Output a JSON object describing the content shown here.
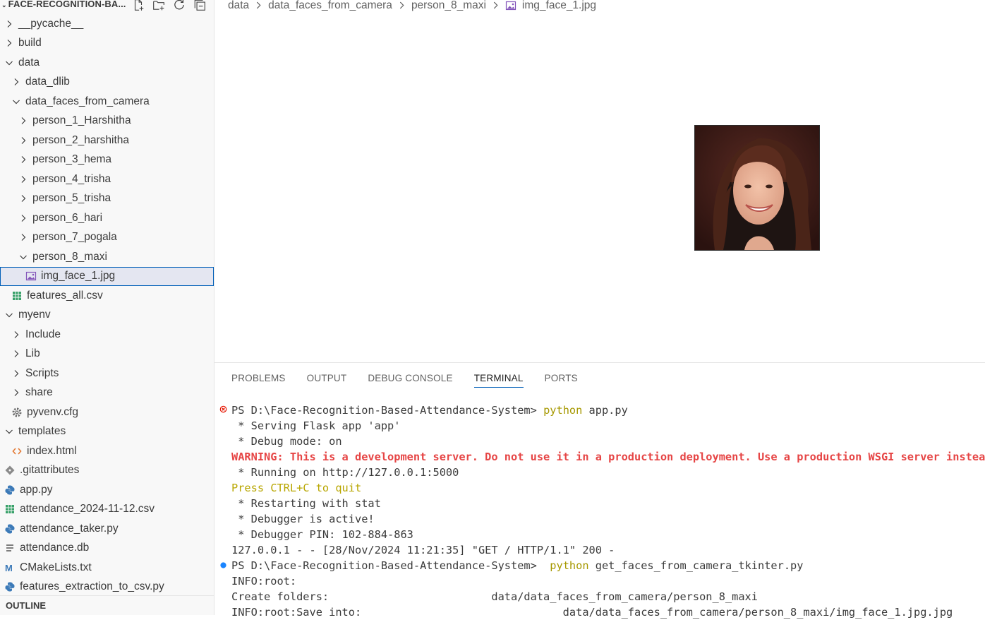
{
  "sidebar": {
    "title": "FACE-RECOGNITION-BA...",
    "header_icons": [
      "new-file-icon",
      "new-folder-icon",
      "refresh-icon",
      "collapse-all-icon"
    ],
    "items": [
      {
        "label": "__pycache__",
        "kind": "folder",
        "expanded": false,
        "depth": 0
      },
      {
        "label": "build",
        "kind": "folder",
        "expanded": false,
        "depth": 0
      },
      {
        "label": "data",
        "kind": "folder",
        "expanded": true,
        "depth": 0
      },
      {
        "label": "data_dlib",
        "kind": "folder",
        "expanded": false,
        "depth": 1
      },
      {
        "label": "data_faces_from_camera",
        "kind": "folder",
        "expanded": true,
        "depth": 1
      },
      {
        "label": "person_1_Harshitha",
        "kind": "folder",
        "expanded": false,
        "depth": 2
      },
      {
        "label": "person_2_harshitha",
        "kind": "folder",
        "expanded": false,
        "depth": 2
      },
      {
        "label": "person_3_hema",
        "kind": "folder",
        "expanded": false,
        "depth": 2
      },
      {
        "label": "person_4_trisha",
        "kind": "folder",
        "expanded": false,
        "depth": 2
      },
      {
        "label": "person_5_trisha",
        "kind": "folder",
        "expanded": false,
        "depth": 2
      },
      {
        "label": "person_6_hari",
        "kind": "folder",
        "expanded": false,
        "depth": 2
      },
      {
        "label": "person_7_pogala",
        "kind": "folder",
        "expanded": false,
        "depth": 2
      },
      {
        "label": "person_8_maxi",
        "kind": "folder",
        "expanded": true,
        "depth": 2
      },
      {
        "label": "img_face_1.jpg",
        "kind": "image",
        "depth": 3,
        "selected": true
      },
      {
        "label": "features_all.csv",
        "kind": "csv",
        "depth": 1
      },
      {
        "label": "myenv",
        "kind": "folder",
        "expanded": true,
        "depth": 0
      },
      {
        "label": "Include",
        "kind": "folder",
        "expanded": false,
        "depth": 1
      },
      {
        "label": "Lib",
        "kind": "folder",
        "expanded": false,
        "depth": 1
      },
      {
        "label": "Scripts",
        "kind": "folder",
        "expanded": false,
        "depth": 1
      },
      {
        "label": "share",
        "kind": "folder",
        "expanded": false,
        "depth": 1
      },
      {
        "label": "pyvenv.cfg",
        "kind": "cfg",
        "depth": 1
      },
      {
        "label": "templates",
        "kind": "folder",
        "expanded": true,
        "depth": 0
      },
      {
        "label": "index.html",
        "kind": "html",
        "depth": 1
      },
      {
        "label": ".gitattributes",
        "kind": "git",
        "depth": 0
      },
      {
        "label": "app.py",
        "kind": "python",
        "depth": 0
      },
      {
        "label": "attendance_2024-11-12.csv",
        "kind": "csv",
        "depth": 0
      },
      {
        "label": "attendance_taker.py",
        "kind": "python",
        "depth": 0
      },
      {
        "label": "attendance.db",
        "kind": "db",
        "depth": 0
      },
      {
        "label": "CMakeLists.txt",
        "kind": "cmake",
        "depth": 0
      },
      {
        "label": "features_extraction_to_csv.py",
        "kind": "python",
        "depth": 0
      }
    ],
    "outline_label": "OUTLINE"
  },
  "breadcrumb": [
    "data",
    "data_faces_from_camera",
    "person_8_maxi",
    "img_face_1.jpg"
  ],
  "colors": {
    "accent": "#005fb8",
    "folder_twisty": "#3b3b3b",
    "csv_icon": "#38a169",
    "python_icon": "#3c7ab8",
    "html_icon": "#e37933",
    "image_icon": "#8354ba",
    "terminal_error": "#e64545",
    "terminal_command": "#a69800",
    "terminal_success_dot": "#1a85ff",
    "terminal_error_dot": "#e51400"
  },
  "panel": {
    "tabs": [
      {
        "label": "PROBLEMS",
        "active": false
      },
      {
        "label": "OUTPUT",
        "active": false
      },
      {
        "label": "DEBUG CONSOLE",
        "active": false
      },
      {
        "label": "TERMINAL",
        "active": true
      },
      {
        "label": "PORTS",
        "active": false
      }
    ]
  },
  "terminal": {
    "prompt1": "PS D:\\Face-Recognition-Based-Attendance-System> ",
    "cmd1_name": "python",
    "cmd1_arg": " app.py",
    "l2": " * Serving Flask app 'app'",
    "l3": " * Debug mode: on",
    "l4": "WARNING: This is a development server. Do not use it in a production deployment. Use a production WSGI server instead.",
    "l5": " * Running on http://127.0.0.1:5000",
    "l6": "Press CTRL+C to quit",
    "l7": " * Restarting with stat",
    "l8": " * Debugger is active!",
    "l9": " * Debugger PIN: 102-884-863",
    "l10": "127.0.0.1 - - [28/Nov/2024 11:21:35] \"GET / HTTP/1.1\" 200 -",
    "prompt2": "PS D:\\Face-Recognition-Based-Attendance-System>  ",
    "cmd2_name": "python",
    "cmd2_arg": " get_faces_from_camera_tkinter.py",
    "l12": "INFO:root:",
    "l13": "Create folders:                         data/data_faces_from_camera/person_8_maxi",
    "l14": "INFO:root:Save into:                               data/data_faces_from_camera/person_8_maxi/img_face_1.jpg.jpg"
  }
}
